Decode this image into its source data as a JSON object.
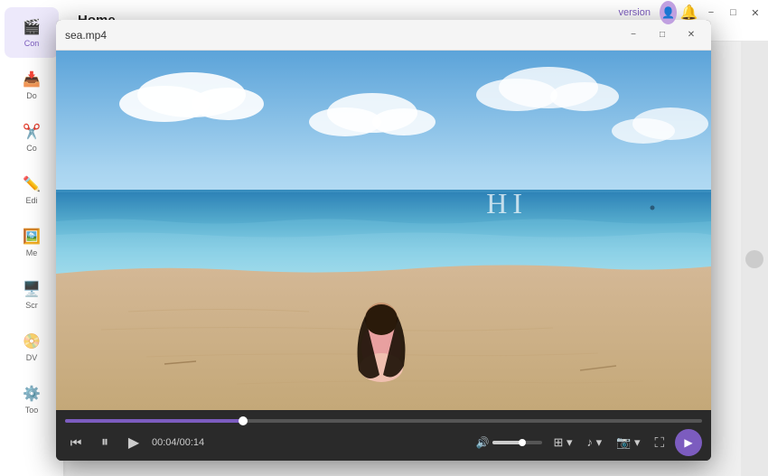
{
  "app": {
    "title": "Home",
    "upgrade_text": "version"
  },
  "sidebar": {
    "items": [
      {
        "label": "Con",
        "icon": "🎬",
        "active": true,
        "id": "convert"
      },
      {
        "label": "Do",
        "icon": "📥",
        "active": false,
        "id": "download"
      },
      {
        "label": "Co",
        "icon": "✂️",
        "active": false,
        "id": "compress"
      },
      {
        "label": "Edi",
        "icon": "✏️",
        "active": false,
        "id": "edit"
      },
      {
        "label": "Me",
        "icon": "🖼️",
        "active": false,
        "id": "media"
      },
      {
        "label": "Scr",
        "icon": "🖥️",
        "active": false,
        "id": "screen"
      },
      {
        "label": "DV",
        "icon": "📀",
        "active": false,
        "id": "dvd"
      },
      {
        "label": "Too",
        "icon": "⚙️",
        "active": false,
        "id": "toolbox"
      }
    ]
  },
  "video_player": {
    "title": "sea.mp4",
    "watermark": "HI",
    "time_current": "00:04",
    "time_total": "00:14",
    "progress_percent": 28,
    "volume_percent": 60
  },
  "window_controls": {
    "minimize": "−",
    "maximize": "□",
    "close": "✕"
  }
}
